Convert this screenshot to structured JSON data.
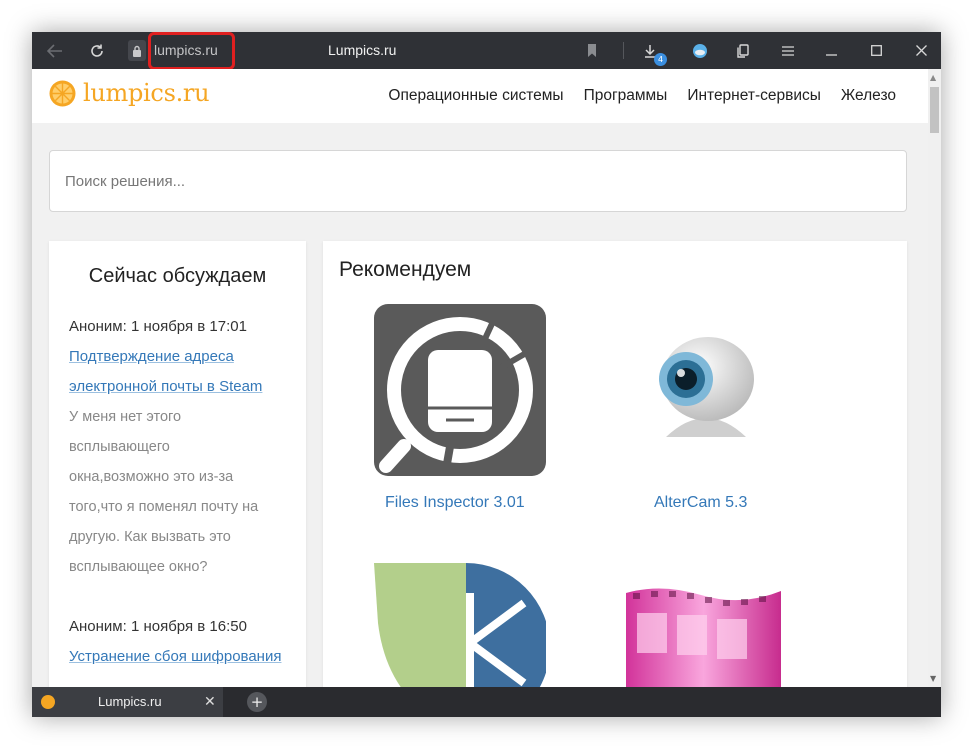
{
  "browser": {
    "url": "lumpics.ru",
    "window_title": "Lumpics.ru",
    "downloads_count": "4",
    "tab_label": "Lumpics.ru"
  },
  "site": {
    "logo_text": "lumpics.ru",
    "nav": [
      "Операционные системы",
      "Программы",
      "Интернет-сервисы",
      "Железо"
    ]
  },
  "search": {
    "placeholder": "Поиск решения..."
  },
  "sidebar": {
    "title": "Сейчас обсуждаем",
    "comments": [
      {
        "meta": "Аноним: 1 ноября в 17:01",
        "link_lines": [
          "Подтверждение адреса",
          "электронной почты в Steam"
        ],
        "body_lines": [
          "У меня нет этого",
          "всплывающего",
          "окна,возможно это из-за",
          "того,что я поменял почту на",
          "другую. Как вызвать это",
          "всплывающее окно?"
        ]
      },
      {
        "meta": "Аноним: 1 ноября в 16:50",
        "link_lines": [
          "Устранение сбоя шифрования"
        ],
        "body_lines": []
      }
    ]
  },
  "main": {
    "title": "Рекомендуем",
    "cards": [
      {
        "title": "Files Inspector 3.01"
      },
      {
        "title": "AlterCam 5.3"
      }
    ]
  },
  "colors": {
    "accent": "#f5a623",
    "link": "#3478b8",
    "highlight": "#e02020"
  }
}
